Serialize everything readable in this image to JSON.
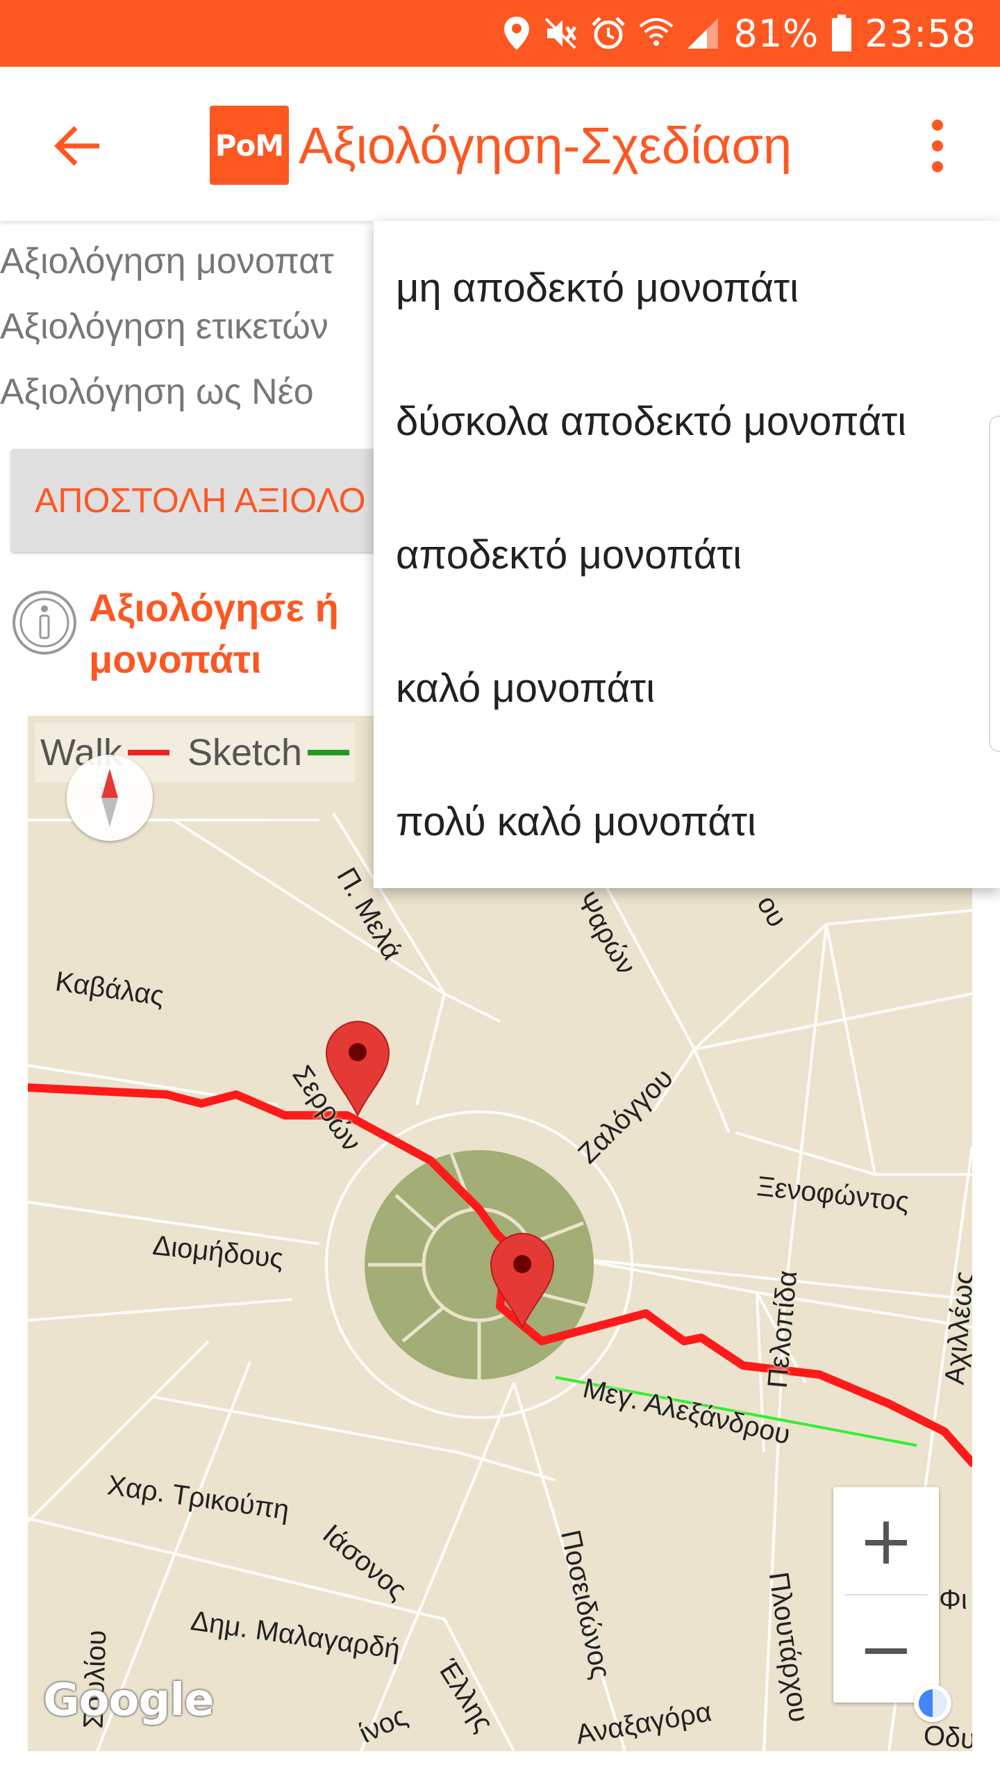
{
  "status_bar": {
    "battery_percent": "81%",
    "time": "23:58",
    "icons": [
      "location-icon",
      "mute-icon",
      "alarm-icon",
      "wifi-icon",
      "signal-icon",
      "battery-icon"
    ]
  },
  "app_bar": {
    "logo_text": "PoM",
    "title": "Αξιολόγηση-Σχεδίαση",
    "back_icon": "arrow-back-icon",
    "overflow_icon": "more-vert-icon"
  },
  "content": {
    "rating_rows": [
      "Αξιολόγηση μονοπατ",
      "Αξιολόγηση ετικετών",
      "Αξιολόγηση ως Νέο"
    ],
    "send_button": "ΑΠΟΣΤΟΛΗ ΑΞΙΟΛΟ",
    "info_text": "Αξιολόγησε ή μονοπάτι"
  },
  "map": {
    "legend": {
      "walk_label": "Walk",
      "sketch_label": "Sketch",
      "walk_color": "#ee2222",
      "sketch_color": "#229922"
    },
    "route_color": "#ff1a1a",
    "sketch_line_color": "#33ee33",
    "street_labels": {
      "p_mela": "Π. Μελά",
      "psaron": "Ψαρών",
      "kavalas": "Καβάλας",
      "serron": "Σερρών",
      "zalongou": "Ζαλόγγου",
      "xenofontos": "Ξενοφώντος",
      "diomidous": "Διομήδους",
      "pelopida": "Πελοπίδα",
      "achillews": "Αχιλλέως",
      "meg_alexandrou": "Μεγ. Αλεξάνδρου",
      "har_trikoupi": "Χαρ. Τρικούπη",
      "iasonos": "Ιάσονος",
      "poseidonos": "Ποσειδώνος",
      "ploutarhou": "Πλουτάρχου",
      "souliou": "Σουλίου",
      "dim_malagardi": "Δημ. Μαλαγαρδή",
      "ellis": "Έλλης",
      "anaxagora": "Αναξαγόρα",
      "fi": "Φι",
      "odi": "Οδυ",
      "ou": "ου",
      "inos": "ίνος"
    },
    "zoom_in": "+",
    "zoom_out": "−",
    "attribution": "Google"
  },
  "dropdown_menu": {
    "items": [
      "μη αποδεκτό μονοπάτι",
      "δύσκολα αποδεκτό μονοπάτι",
      "αποδεκτό μονοπάτι",
      "καλό μονοπάτι",
      "πολύ καλό μονοπάτι"
    ]
  }
}
